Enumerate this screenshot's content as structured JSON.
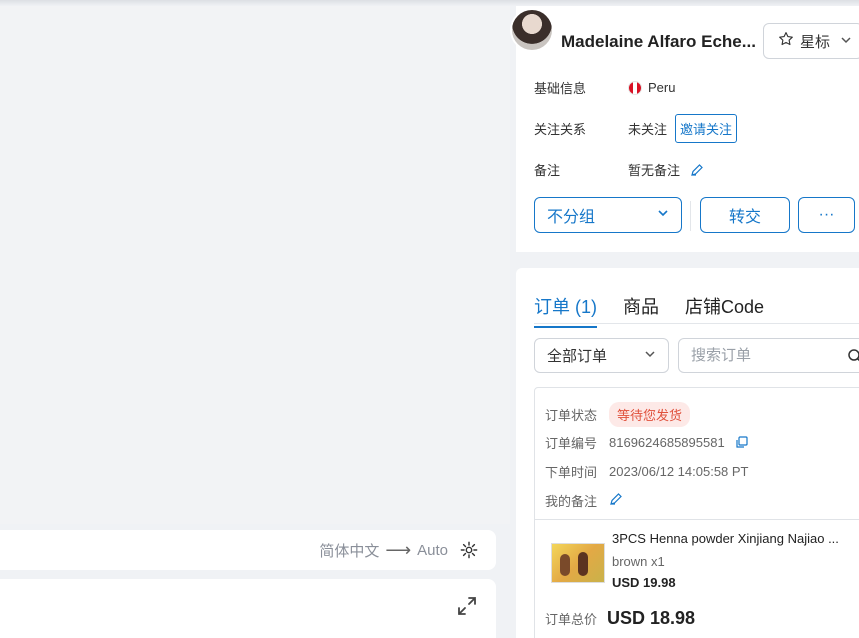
{
  "translate_bar": {
    "source_lang": "简体中文",
    "arrow": "⟶",
    "target_lang": "Auto"
  },
  "profile": {
    "name": "Madelaine Alfaro Eche...",
    "star_button": "星标",
    "basic_info_label": "基础信息",
    "country": "Peru",
    "follow_label": "关注关系",
    "follow_status": "未关注",
    "invite_button": "邀请关注",
    "note_label": "备注",
    "note_value": "暂无备注",
    "group_select": "不分组",
    "transfer_button": "转交",
    "more_button": "···"
  },
  "orders": {
    "tabs": [
      {
        "label": "订单 (1)",
        "active": true
      },
      {
        "label": "商品",
        "active": false
      },
      {
        "label": "店铺Code",
        "active": false
      }
    ],
    "status_filter": "全部订单",
    "search_placeholder": "搜索订单",
    "card": {
      "status_label": "订单状态",
      "status_value": "等待您发货",
      "number_label": "订单编号",
      "number_value": "8169624685895581",
      "time_label": "下单时间",
      "time_value": "2023/06/12 14:05:58 PT",
      "my_note_label": "我的备注",
      "product_title": "3PCS Henna powder Xinjiang Najiao ...",
      "product_variant": "brown x1",
      "product_price": "USD 19.98",
      "total_label": "订单总价",
      "total_value": "USD 18.98"
    }
  },
  "colors": {
    "accent": "#1677c9",
    "status_red": "#e0513c",
    "status_bg": "#fde9e7"
  }
}
